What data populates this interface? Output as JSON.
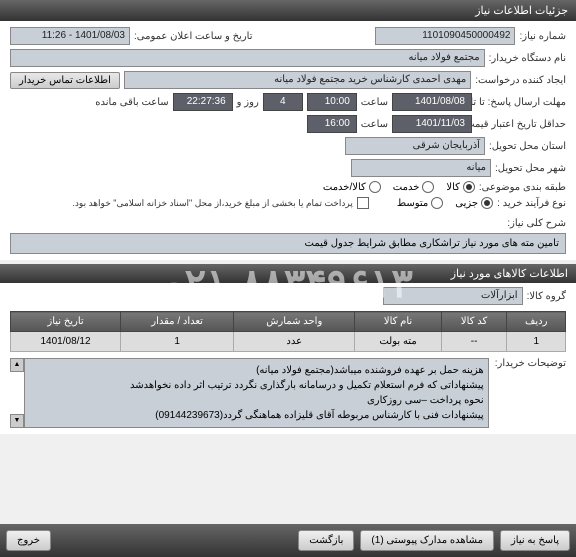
{
  "header": {
    "title": "جزئیات اطلاعات نیاز"
  },
  "form": {
    "need_number_label": "شماره نیاز:",
    "need_number": "1101090450000492",
    "announce_date_label": "تاریخ و ساعت اعلان عمومی:",
    "announce_date": "1401/08/03 - 11:26",
    "buyer_org_label": "نام دستگاه خریدار:",
    "buyer_org": "مجتمع فولاد میانه",
    "requester_label": "ایجاد کننده درخواست:",
    "requester": "مهدی احمدی کارشناس خرید مجتمع فولاد میانه",
    "contact_btn": "اطلاعات تماس خریدار",
    "deadline_label": "مهلت ارسال پاسخ: تا تاریخ:",
    "deadline_date": "1401/08/08",
    "time_label": "ساعت",
    "deadline_time": "10:00",
    "days_count": "4",
    "days_label": "روز و",
    "countdown": "22:27:36",
    "remaining_label": "ساعت باقی مانده",
    "validity_label": "حداقل تاریخ اعتبار قیمت: تا تاریخ:",
    "validity_date": "1401/11/03",
    "validity_time": "16:00",
    "province_label": "استان محل تحویل:",
    "province": "آذربایجان شرقی",
    "city_label": "شهر محل تحویل:",
    "city": "میانه",
    "category_label": "طبقه بندی موضوعی:",
    "cat_goods": "کالا",
    "cat_service": "خدمت",
    "cat_both": "کالا/خدمت",
    "purchase_type_label": "نوع فرآیند خرید :",
    "pt_partial": "جزیی",
    "pt_medium": "متوسط",
    "payment_note": "پرداخت تمام یا بخشی از مبلغ خرید،از محل \"اسناد خزانه اسلامی\" خواهد بود.",
    "desc_label": "شرح کلی نیاز:",
    "desc_text": "تامین مته های مورد نیاز تراشکاری مطابق شرایط جدول قیمت"
  },
  "goods_section": {
    "title": "اطلاعات کالاهای مورد نیاز",
    "group_label": "گروه کالا:",
    "group_value": "ابزارآلات"
  },
  "table": {
    "headers": {
      "row": "ردیف",
      "code": "کد کالا",
      "name": "نام کالا",
      "unit": "واحد شمارش",
      "qty": "تعداد / مقدار",
      "date": "تاریخ نیاز"
    },
    "rows": [
      {
        "row": "1",
        "code": "--",
        "name": "مته بولت",
        "unit": "عدد",
        "qty": "1",
        "date": "1401/08/12"
      }
    ]
  },
  "buyer_notes": {
    "label": "توضیحات خریدار:",
    "line1": "هزینه حمل بر عهده فروشنده میباشد(مجتمع فولاد میانه)",
    "line2": "پیشنهاداتی که فرم استعلام تکمیل و درسامانه بارگذاری نگردد ترتیب اثر داده نخواهدشد",
    "line3": "نحوه پرداخت –سی روزکاری",
    "line4": "پیشنهادات فنی با کارشناس مربوطه آقای قلیزاده هماهنگی گردد(09144239673)"
  },
  "bottom": {
    "respond": "پاسخ به نیاز",
    "attachments": "مشاهده مدارک پیوستی (1)",
    "back": "بازگشت",
    "exit": "خروج"
  },
  "watermark": "۰۲۱-۸۸۳۴۹۶۱۳"
}
